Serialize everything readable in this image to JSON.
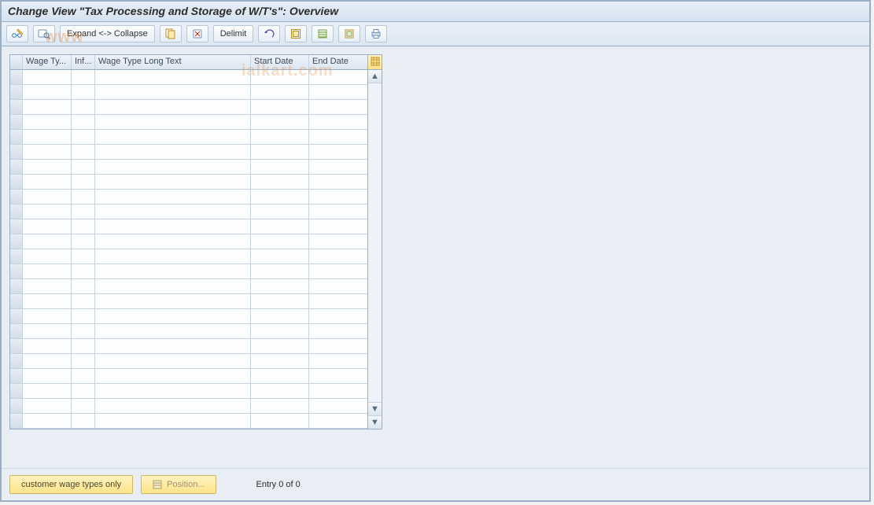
{
  "title": "Change View \"Tax Processing and Storage of W/T's\": Overview",
  "toolbar": {
    "expand_collapse_label": "Expand <-> Collapse",
    "delimit_label": "Delimit"
  },
  "grid": {
    "columns": {
      "wage_type": "Wage Ty...",
      "inf": "Inf...",
      "long_text": "Wage Type Long Text",
      "start_date": "Start Date",
      "end_date": "End Date"
    },
    "row_count": 24
  },
  "footer": {
    "customer_btn_label": "customer wage types only",
    "position_btn_label": "Position...",
    "entry_label": "Entry 0 of 0"
  },
  "watermark_a": "www",
  "watermark_b": "ialkart.com"
}
